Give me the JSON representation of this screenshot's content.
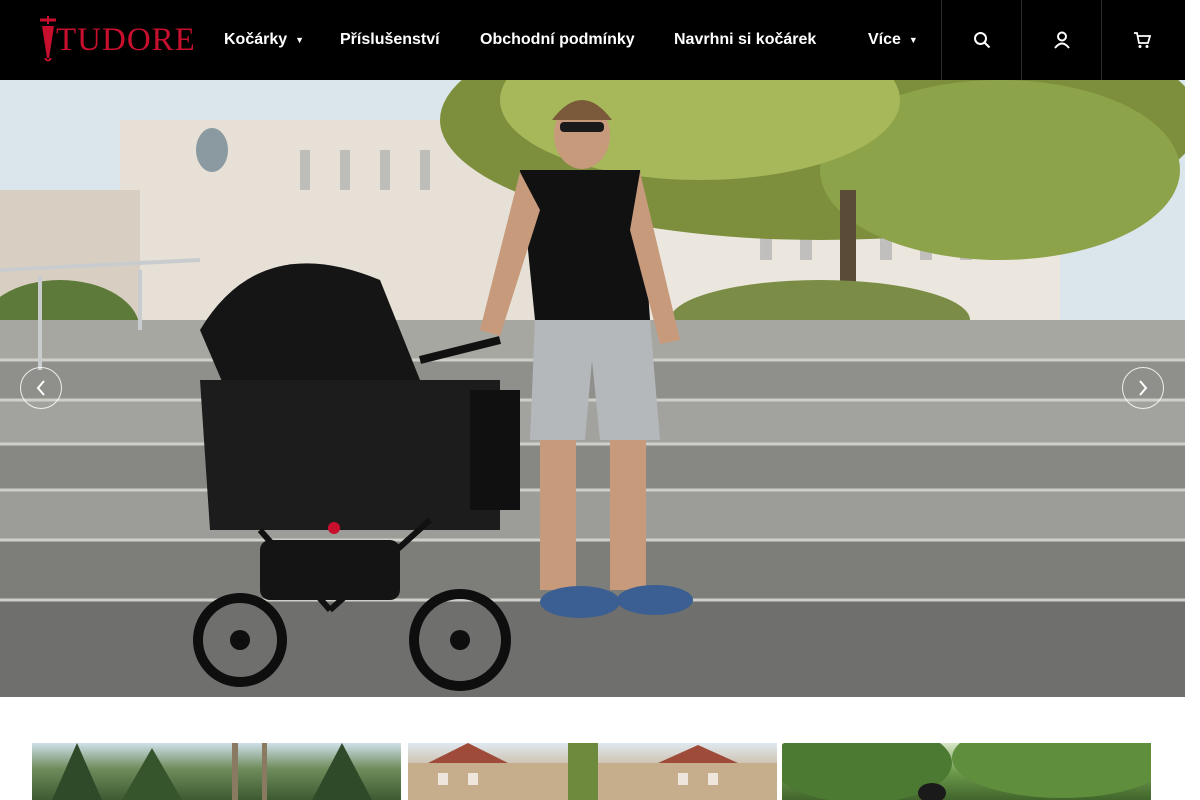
{
  "brand": {
    "name": "TUDORE",
    "color": "#c8102e",
    "logo_icon": "tudore-logo"
  },
  "nav": {
    "items": [
      {
        "label": "Kočárky",
        "has_dropdown": true
      },
      {
        "label": "Příslušenství",
        "has_dropdown": false
      },
      {
        "label": "Obchodní podmínky",
        "has_dropdown": false
      },
      {
        "label": "Navrhni si kočárek",
        "has_dropdown": false
      },
      {
        "label": "Více",
        "has_dropdown": true
      }
    ],
    "dropdown_icon": "chevron-down-icon"
  },
  "header_buttons": [
    {
      "icon": "search-icon"
    },
    {
      "icon": "user-icon"
    },
    {
      "icon": "cart-icon"
    }
  ],
  "hero": {
    "image": "man-with-black-pram-on-city-steps",
    "prev_icon": "chevron-left-icon",
    "next_icon": "chevron-right-icon"
  },
  "thumbnails": [
    {
      "image": "pram-among-trees"
    },
    {
      "image": "pram-by-city-buildings"
    },
    {
      "image": "pram-in-green-park"
    }
  ],
  "colors": {
    "header_bg": "#000000",
    "nav_text": "#ffffff",
    "brand_red": "#c8102e"
  }
}
